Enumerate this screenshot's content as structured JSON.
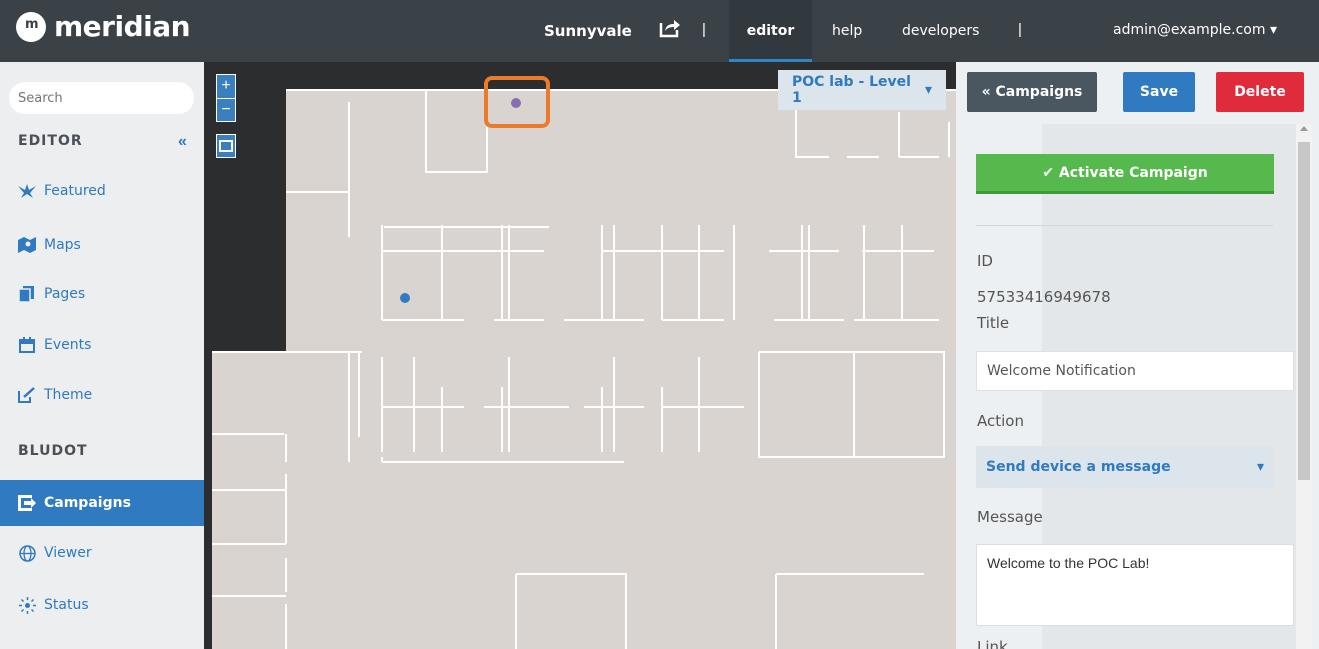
{
  "topbar": {
    "logo_text": "meridian",
    "location": "Sunnyvale",
    "separator": "|",
    "tabs": [
      "editor",
      "help",
      "developers"
    ],
    "user": "admin@example.com"
  },
  "sidebar": {
    "search_placeholder": "Search",
    "sections": [
      "EDITOR",
      "BLUDOT"
    ],
    "collapse": "«",
    "items": [
      {
        "label": "Featured",
        "icon": "featured-icon"
      },
      {
        "label": "Maps",
        "icon": "map-icon"
      },
      {
        "label": "Pages",
        "icon": "pages-icon"
      },
      {
        "label": "Events",
        "icon": "calendar-icon"
      },
      {
        "label": "Theme",
        "icon": "theme-icon"
      },
      {
        "label": "Campaigns",
        "icon": "campaigns-icon"
      },
      {
        "label": "Viewer",
        "icon": "globe-icon"
      },
      {
        "label": "Status",
        "icon": "status-icon"
      }
    ]
  },
  "map": {
    "zoom_in": "+",
    "zoom_out": "−",
    "floor": "POC lab - Level 1"
  },
  "panel": {
    "back_label": "« Campaigns",
    "save_label": "Save",
    "delete_label": "Delete",
    "activate_label": "Activate Campaign",
    "id_label": "ID",
    "id_value": "57533416949678",
    "title_label": "Title",
    "title_value": "Welcome Notification",
    "action_label": "Action",
    "action_value": "Send device a message",
    "message_label": "Message",
    "message_value": "Welcome to the POC Lab!",
    "link_label": "Link"
  }
}
